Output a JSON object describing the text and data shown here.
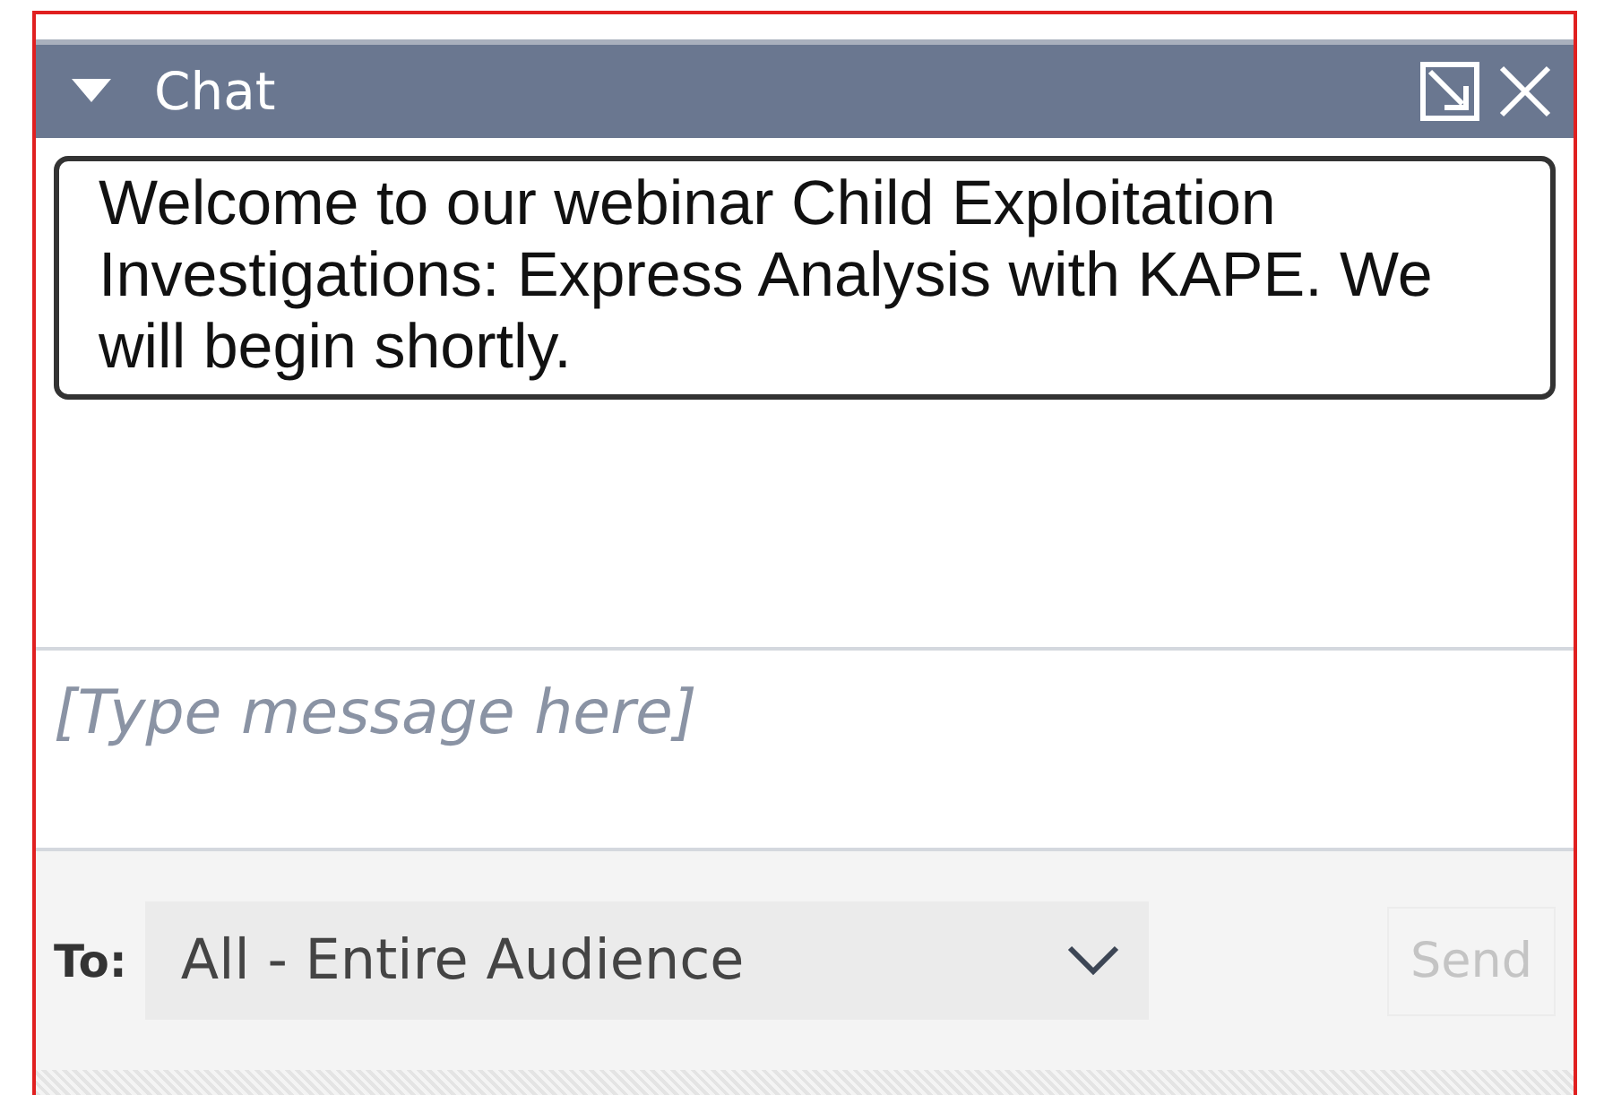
{
  "panel": {
    "title": "Chat",
    "expanded": true
  },
  "messages": [
    {
      "text": "Welcome to our webinar Child Exploitation Investigations: Express Analysis with KAPE. We will begin shortly."
    }
  ],
  "composer": {
    "placeholder": "[Type message here]"
  },
  "recipient": {
    "label": "To:",
    "value": "All - Entire Audience"
  },
  "send_button": {
    "label": "Send",
    "disabled": true
  }
}
